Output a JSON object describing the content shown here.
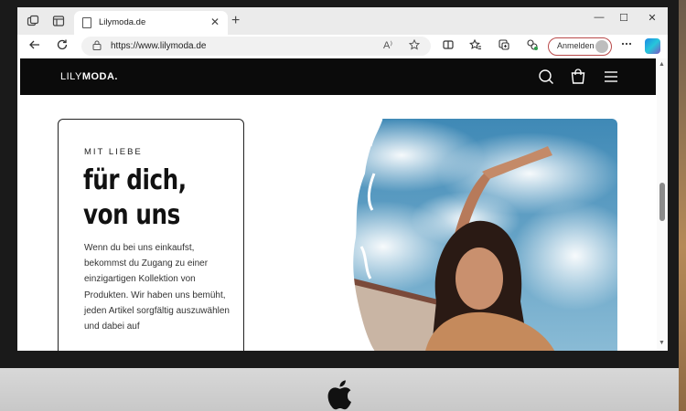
{
  "browser": {
    "tab_title": "Lilymoda.de",
    "tab_close": "✕",
    "new_tab": "+",
    "url": "https://www.lilymoda.de",
    "read_aloud": "A⁾",
    "signin_label": "Anmelden",
    "window_controls": [
      "—",
      "☐",
      "✕"
    ]
  },
  "site": {
    "logo_light": "LILY",
    "logo_bold": "MODA."
  },
  "card": {
    "eyebrow": "MIT LIEBE",
    "title": "für dich, von uns",
    "body": "Wenn du bei uns einkaufst, bekommst du Zugang zu einer einzigartigen Kollektion von Produkten. Wir haben uns bemüht, jeden Artikel sorgfältig auszuwählen und dabei auf"
  },
  "icons": {
    "workspaces": "workspaces-icon",
    "tab_actions": "tab-actions-icon",
    "back": "back-arrow-icon",
    "refresh": "refresh-icon",
    "lock": "lock-icon",
    "favorite": "star-icon",
    "split": "split-screen-icon",
    "favorites": "favorites-icon",
    "collections": "collections-icon",
    "extensions": "extensions-icon",
    "more": "more-icon",
    "copilot": "copilot-icon",
    "search": "search-icon",
    "bag": "shopping-bag-icon",
    "menu": "hamburger-menu-icon"
  },
  "colors": {
    "header_bg": "#0b0b0b",
    "signin_border": "#b94a4a",
    "sky": "#4a90b8"
  }
}
